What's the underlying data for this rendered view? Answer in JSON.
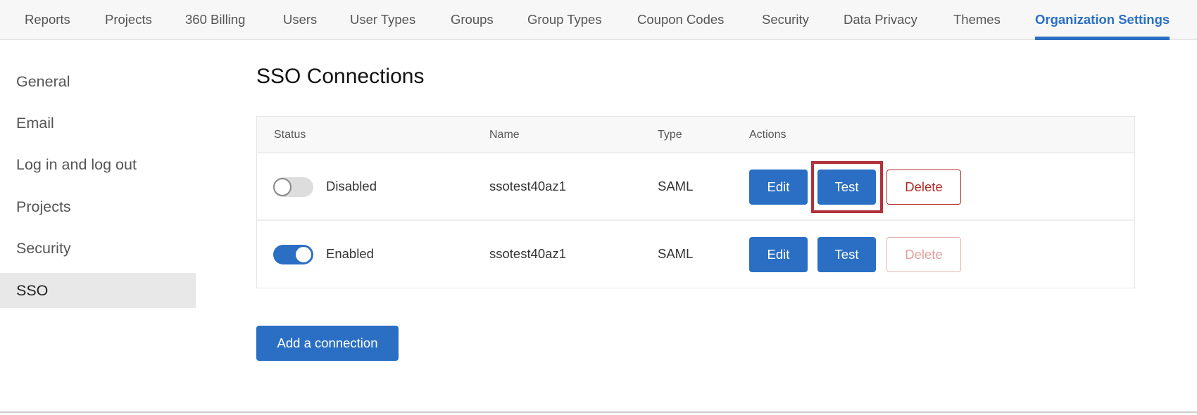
{
  "topnav": {
    "tabs": [
      "Reports",
      "Projects",
      "360 Billing",
      "Users",
      "User Types",
      "Groups",
      "Group Types",
      "Coupon Codes",
      "Security",
      "Data Privacy",
      "Themes",
      "Organization Settings"
    ],
    "active": "Organization Settings"
  },
  "sidebar": {
    "items": [
      "General",
      "Email",
      "Log in and log out",
      "Projects",
      "Security",
      "SSO"
    ],
    "active": "SSO"
  },
  "main": {
    "title": "SSO Connections",
    "table": {
      "headers": {
        "status": "Status",
        "name": "Name",
        "type": "Type",
        "actions": "Actions"
      },
      "rows": [
        {
          "enabled": false,
          "status": "Disabled",
          "name": "ssotest40az1",
          "type": "SAML",
          "edit": "Edit",
          "test": "Test",
          "delete": "Delete",
          "delete_disabled": false,
          "highlighted": "test"
        },
        {
          "enabled": true,
          "status": "Enabled",
          "name": "ssotest40az1",
          "type": "SAML",
          "edit": "Edit",
          "test": "Test",
          "delete": "Delete",
          "delete_disabled": true
        }
      ]
    },
    "add_button": "Add a connection"
  },
  "colors": {
    "accent": "#2a6fc4",
    "danger": "#b02a2a",
    "highlight": "#b0323a"
  }
}
